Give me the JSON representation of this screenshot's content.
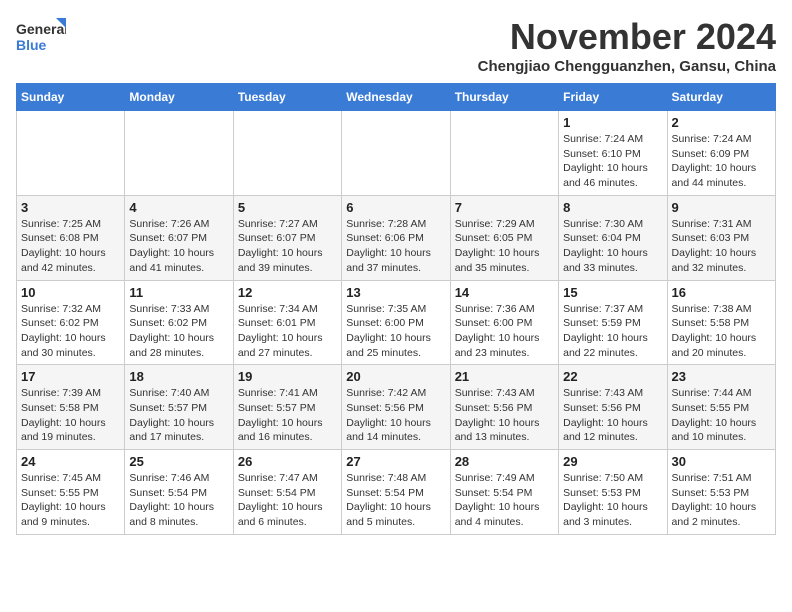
{
  "logo": {
    "line1": "General",
    "line2": "Blue"
  },
  "title": "November 2024",
  "location": "Chengjiao Chengguanzhen, Gansu, China",
  "days_of_week": [
    "Sunday",
    "Monday",
    "Tuesday",
    "Wednesday",
    "Thursday",
    "Friday",
    "Saturday"
  ],
  "weeks": [
    [
      {
        "day": "",
        "info": ""
      },
      {
        "day": "",
        "info": ""
      },
      {
        "day": "",
        "info": ""
      },
      {
        "day": "",
        "info": ""
      },
      {
        "day": "",
        "info": ""
      },
      {
        "day": "1",
        "info": "Sunrise: 7:24 AM\nSunset: 6:10 PM\nDaylight: 10 hours and 46 minutes."
      },
      {
        "day": "2",
        "info": "Sunrise: 7:24 AM\nSunset: 6:09 PM\nDaylight: 10 hours and 44 minutes."
      }
    ],
    [
      {
        "day": "3",
        "info": "Sunrise: 7:25 AM\nSunset: 6:08 PM\nDaylight: 10 hours and 42 minutes."
      },
      {
        "day": "4",
        "info": "Sunrise: 7:26 AM\nSunset: 6:07 PM\nDaylight: 10 hours and 41 minutes."
      },
      {
        "day": "5",
        "info": "Sunrise: 7:27 AM\nSunset: 6:07 PM\nDaylight: 10 hours and 39 minutes."
      },
      {
        "day": "6",
        "info": "Sunrise: 7:28 AM\nSunset: 6:06 PM\nDaylight: 10 hours and 37 minutes."
      },
      {
        "day": "7",
        "info": "Sunrise: 7:29 AM\nSunset: 6:05 PM\nDaylight: 10 hours and 35 minutes."
      },
      {
        "day": "8",
        "info": "Sunrise: 7:30 AM\nSunset: 6:04 PM\nDaylight: 10 hours and 33 minutes."
      },
      {
        "day": "9",
        "info": "Sunrise: 7:31 AM\nSunset: 6:03 PM\nDaylight: 10 hours and 32 minutes."
      }
    ],
    [
      {
        "day": "10",
        "info": "Sunrise: 7:32 AM\nSunset: 6:02 PM\nDaylight: 10 hours and 30 minutes."
      },
      {
        "day": "11",
        "info": "Sunrise: 7:33 AM\nSunset: 6:02 PM\nDaylight: 10 hours and 28 minutes."
      },
      {
        "day": "12",
        "info": "Sunrise: 7:34 AM\nSunset: 6:01 PM\nDaylight: 10 hours and 27 minutes."
      },
      {
        "day": "13",
        "info": "Sunrise: 7:35 AM\nSunset: 6:00 PM\nDaylight: 10 hours and 25 minutes."
      },
      {
        "day": "14",
        "info": "Sunrise: 7:36 AM\nSunset: 6:00 PM\nDaylight: 10 hours and 23 minutes."
      },
      {
        "day": "15",
        "info": "Sunrise: 7:37 AM\nSunset: 5:59 PM\nDaylight: 10 hours and 22 minutes."
      },
      {
        "day": "16",
        "info": "Sunrise: 7:38 AM\nSunset: 5:58 PM\nDaylight: 10 hours and 20 minutes."
      }
    ],
    [
      {
        "day": "17",
        "info": "Sunrise: 7:39 AM\nSunset: 5:58 PM\nDaylight: 10 hours and 19 minutes."
      },
      {
        "day": "18",
        "info": "Sunrise: 7:40 AM\nSunset: 5:57 PM\nDaylight: 10 hours and 17 minutes."
      },
      {
        "day": "19",
        "info": "Sunrise: 7:41 AM\nSunset: 5:57 PM\nDaylight: 10 hours and 16 minutes."
      },
      {
        "day": "20",
        "info": "Sunrise: 7:42 AM\nSunset: 5:56 PM\nDaylight: 10 hours and 14 minutes."
      },
      {
        "day": "21",
        "info": "Sunrise: 7:43 AM\nSunset: 5:56 PM\nDaylight: 10 hours and 13 minutes."
      },
      {
        "day": "22",
        "info": "Sunrise: 7:43 AM\nSunset: 5:56 PM\nDaylight: 10 hours and 12 minutes."
      },
      {
        "day": "23",
        "info": "Sunrise: 7:44 AM\nSunset: 5:55 PM\nDaylight: 10 hours and 10 minutes."
      }
    ],
    [
      {
        "day": "24",
        "info": "Sunrise: 7:45 AM\nSunset: 5:55 PM\nDaylight: 10 hours and 9 minutes."
      },
      {
        "day": "25",
        "info": "Sunrise: 7:46 AM\nSunset: 5:54 PM\nDaylight: 10 hours and 8 minutes."
      },
      {
        "day": "26",
        "info": "Sunrise: 7:47 AM\nSunset: 5:54 PM\nDaylight: 10 hours and 6 minutes."
      },
      {
        "day": "27",
        "info": "Sunrise: 7:48 AM\nSunset: 5:54 PM\nDaylight: 10 hours and 5 minutes."
      },
      {
        "day": "28",
        "info": "Sunrise: 7:49 AM\nSunset: 5:54 PM\nDaylight: 10 hours and 4 minutes."
      },
      {
        "day": "29",
        "info": "Sunrise: 7:50 AM\nSunset: 5:53 PM\nDaylight: 10 hours and 3 minutes."
      },
      {
        "day": "30",
        "info": "Sunrise: 7:51 AM\nSunset: 5:53 PM\nDaylight: 10 hours and 2 minutes."
      }
    ]
  ]
}
